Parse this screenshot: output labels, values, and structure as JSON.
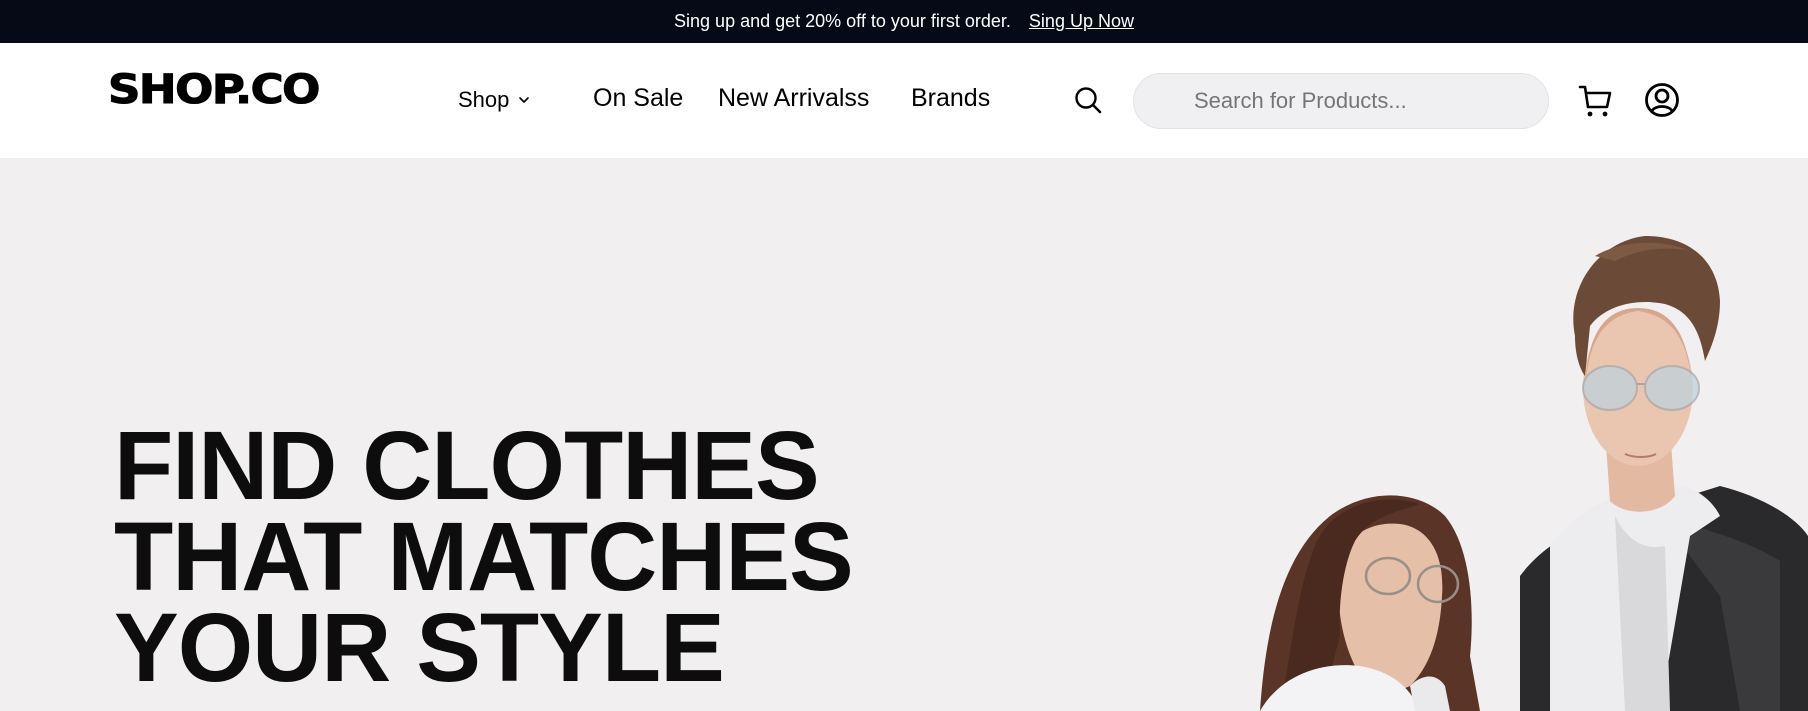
{
  "announcement": {
    "text": "Sing up and get 20% off to your first order.",
    "link_label": "Sing Up Now"
  },
  "header": {
    "logo": "SHOP.CO",
    "nav": {
      "shop_label": "Shop",
      "on_sale": "On Sale",
      "new_arrivals": "New Arrivalss",
      "brands": "Brands"
    },
    "search": {
      "placeholder": "Search for Products..."
    },
    "icons": [
      "search-icon",
      "cart-icon",
      "account-icon",
      "chevron-down-icon"
    ]
  },
  "hero": {
    "title_lines": [
      "FIND CLOTHES",
      "THAT MATCHES",
      "YOUR STYLE"
    ],
    "image_alt": "couple-photo"
  },
  "colors": {
    "topbar_bg": "#060A17",
    "hero_bg": "#F1EFF0",
    "search_bg": "#F0F0F2",
    "text": "#000000"
  }
}
